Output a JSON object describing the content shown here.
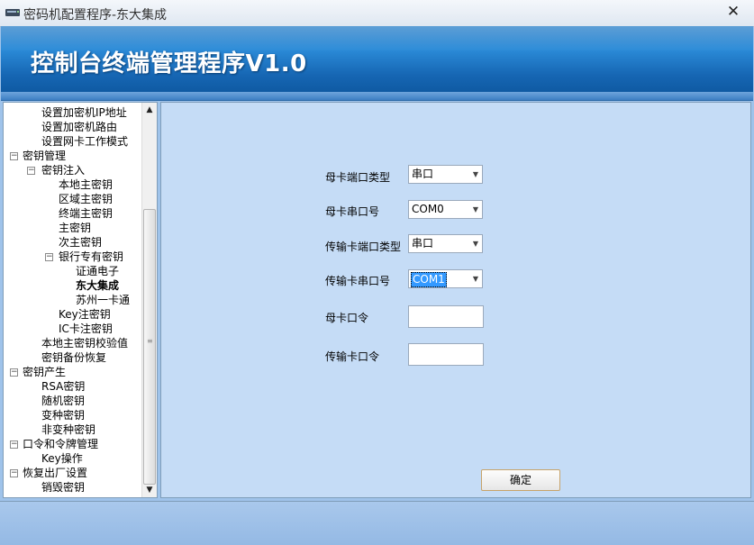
{
  "window": {
    "title": "密码机配置程序-东大集成",
    "close_glyph": "✕"
  },
  "banner": {
    "heading": "控制台终端管理程序V1.0"
  },
  "tree": {
    "items": [
      {
        "label": "设置加密机IP地址",
        "level": 2,
        "toggle": null
      },
      {
        "label": "设置加密机路由",
        "level": 2,
        "toggle": null
      },
      {
        "label": "设置网卡工作模式",
        "level": 2,
        "toggle": null
      },
      {
        "label": "密钥管理",
        "level": 1,
        "toggle": "−"
      },
      {
        "label": "密钥注入",
        "level": 2,
        "toggle": "−"
      },
      {
        "label": "本地主密钥",
        "level": 3,
        "toggle": null
      },
      {
        "label": "区域主密钥",
        "level": 3,
        "toggle": null
      },
      {
        "label": "终端主密钥",
        "level": 3,
        "toggle": null
      },
      {
        "label": "主密钥",
        "level": 3,
        "toggle": null
      },
      {
        "label": "次主密钥",
        "level": 3,
        "toggle": null
      },
      {
        "label": "银行专有密钥",
        "level": 3,
        "toggle": "−"
      },
      {
        "label": "证通电子",
        "level": 4,
        "toggle": null
      },
      {
        "label": "东大集成",
        "level": 4,
        "toggle": null,
        "selected": true
      },
      {
        "label": "苏州一卡通",
        "level": 4,
        "toggle": null
      },
      {
        "label": "Key注密钥",
        "level": 3,
        "toggle": null
      },
      {
        "label": "IC卡注密钥",
        "level": 3,
        "toggle": null
      },
      {
        "label": "本地主密钥校验值",
        "level": 2,
        "toggle": null
      },
      {
        "label": "密钥备份恢复",
        "level": 2,
        "toggle": null
      },
      {
        "label": "密钥产生",
        "level": 1,
        "toggle": "−"
      },
      {
        "label": "RSA密钥",
        "level": 2,
        "toggle": null
      },
      {
        "label": "随机密钥",
        "level": 2,
        "toggle": null
      },
      {
        "label": "变种密钥",
        "level": 2,
        "toggle": null
      },
      {
        "label": "非变种密钥",
        "level": 2,
        "toggle": null
      },
      {
        "label": "口令和令牌管理",
        "level": 1,
        "toggle": "−"
      },
      {
        "label": "Key操作",
        "level": 2,
        "toggle": null
      },
      {
        "label": "恢复出厂设置",
        "level": 1,
        "toggle": "−"
      },
      {
        "label": "销毁密钥",
        "level": 2,
        "toggle": null
      }
    ]
  },
  "form": {
    "mother_port_type_label": "母卡端口类型",
    "mother_port_type_value": "串口",
    "mother_serial_label": "母卡串口号",
    "mother_serial_value": "COM0",
    "transfer_port_type_label": "传输卡端口类型",
    "transfer_port_type_value": "串口",
    "transfer_serial_label": "传输卡串口号",
    "transfer_serial_value": "COM1",
    "mother_password_label": "母卡口令",
    "mother_password_value": "",
    "transfer_password_label": "传输卡口令",
    "transfer_password_value": "",
    "confirm_label": "确定"
  }
}
